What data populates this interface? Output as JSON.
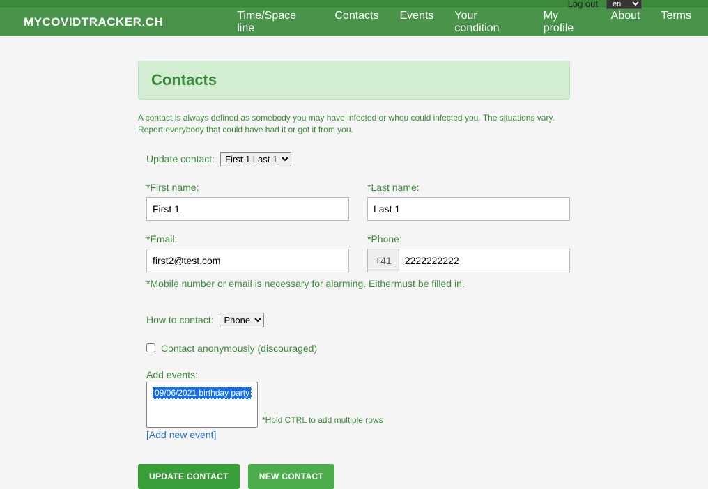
{
  "topbar": {
    "logout": "Log out",
    "lang": "en"
  },
  "brand": "MYCOVIDTRACKER.CH",
  "nav": {
    "timespace": "Time/Space line",
    "contacts": "Contacts",
    "events": "Events",
    "condition": "Your condition",
    "profile": "My profile",
    "about": "About",
    "terms": "Terms"
  },
  "page": {
    "title": "Contacts",
    "intro": "A contact is always defined as somebody you may have infected or whou could infected you. The situations vary. Report everybody that could have had it or got it from you."
  },
  "form": {
    "update_contact_label": "Update contact:",
    "contact_select_value": "First 1 Last 1",
    "first_name_label": "*First name:",
    "first_name_value": "First 1",
    "last_name_label": "*Last name:",
    "last_name_value": "Last 1",
    "email_label": "*Email:",
    "email_value": "first2@test.com",
    "phone_label": "*Phone:",
    "phone_prefix": "+41",
    "phone_value": "2222222222",
    "contact_hint": "*Mobile number or email is necessary for alarming. Eithermust be filled in.",
    "how_to_contact_label": "How to contact:",
    "how_to_contact_value": "Phone",
    "anon_label": "Contact anonymously (discouraged)",
    "add_events_label": "Add events:",
    "events": [
      "09/06/2021 birthday party"
    ],
    "events_hint": "*Hold CTRL to add multiple rows",
    "add_event_link": "[Add new event]"
  },
  "buttons": {
    "update": "UPDATE CONTACT",
    "new": "NEW CONTACT"
  }
}
